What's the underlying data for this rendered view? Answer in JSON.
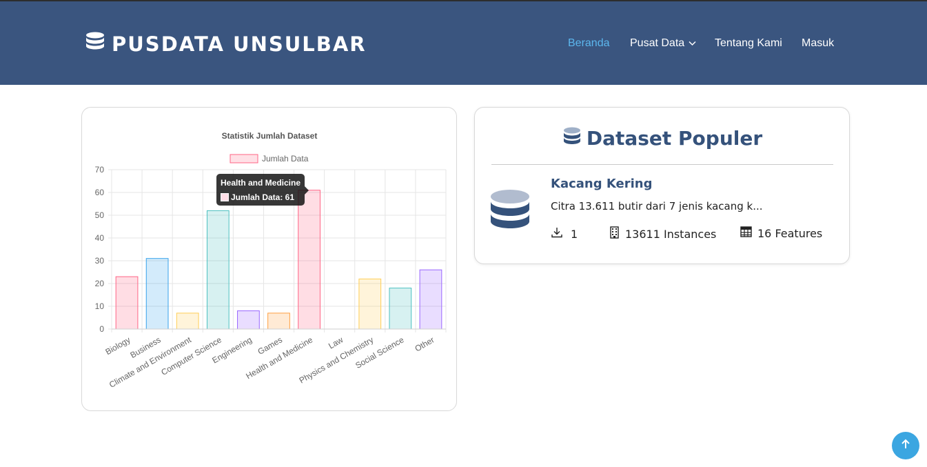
{
  "brand": {
    "name": "PUSDATA UNSULBAR",
    "icon": "database-icon"
  },
  "nav": {
    "items": [
      {
        "label": "Beranda",
        "active": true
      },
      {
        "label": "Pusat Data",
        "dropdown": true
      },
      {
        "label": "Tentang Kami"
      },
      {
        "label": "Masuk"
      }
    ]
  },
  "chart_data": {
    "type": "bar",
    "title": "Statistik Jumlah Dataset",
    "categories": [
      "Biology",
      "Business",
      "Climate and Environment",
      "Computer Science",
      "Engineering",
      "Games",
      "Health and Medicine",
      "Law",
      "Physics and Chemistry",
      "Social Science",
      "Other"
    ],
    "series": [
      {
        "name": "Jumlah Data",
        "values": [
          23,
          31,
          7,
          52,
          8,
          7,
          61,
          0,
          22,
          18,
          26
        ]
      }
    ],
    "colors": [
      "#ff6384",
      "#36a2eb",
      "#ffce56",
      "#4bc0c0",
      "#9966ff",
      "#ff9f40",
      "#ff6384",
      "#36a2eb",
      "#ffce56",
      "#4bc0c0",
      "#9966ff"
    ],
    "ylim": [
      0,
      70
    ],
    "yticks": [
      "0",
      "10",
      "20",
      "30",
      "40",
      "50",
      "60",
      "70"
    ],
    "legend_position": "top",
    "grid": true,
    "tooltip": {
      "title": "Health and Medicine",
      "label": "Jumlah Data: 61"
    }
  },
  "popular": {
    "title": "Dataset Populer",
    "item": {
      "name": "Kacang Kering",
      "description": "Citra 13.611 butir dari 7 jenis kacang k...",
      "downloads": "1",
      "instances": "13611 Instances",
      "features": "16 Features"
    }
  },
  "colors": {
    "header": "#3a557f",
    "accent": "#5cb7ee",
    "title": "#35527b",
    "scroll_button": "#3ba6e1"
  }
}
